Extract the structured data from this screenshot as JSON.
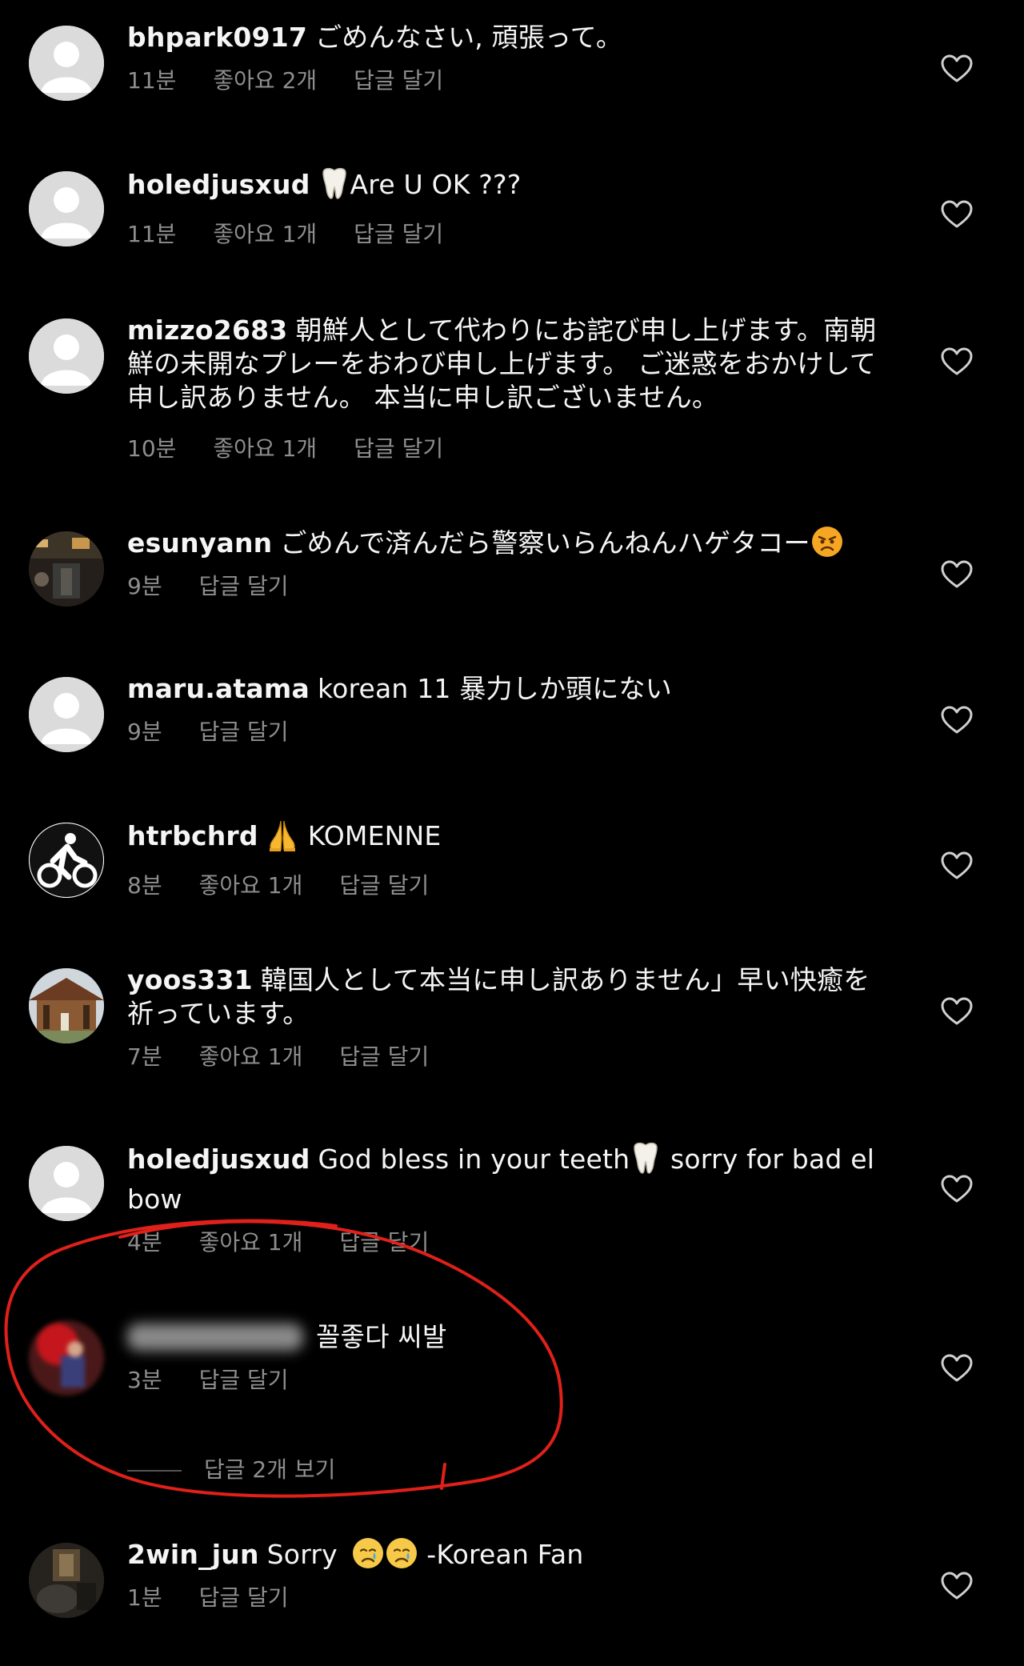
{
  "reply_label": "답글 달기",
  "comments": [
    {
      "username": "bhpark0917",
      "text": "ごめんなさい, 頑張って。",
      "time": "11분",
      "likes": "좋아요 2개"
    },
    {
      "username": "holedjusxud",
      "text": "Are U OK ???",
      "time": "11분",
      "likes": "좋아요 1개"
    },
    {
      "username": "mizzo2683",
      "text": "朝鮮人として代わりにお詫び申し上げます。南朝鮮の未開なプレーをおわび申し上げます。 ご迷惑をおかけして申し訳ありません。 本当に申し訳ございません。",
      "time": "10분",
      "likes": "좋아요 1개"
    },
    {
      "username": "esunyann",
      "text": "ごめんで済んだら警察いらんねんハゲタコー",
      "time": "9분",
      "likes": ""
    },
    {
      "username": "maru.atama",
      "text": "korean 11 暴力しか頭にない",
      "time": "9분",
      "likes": ""
    },
    {
      "username": "htrbchrd",
      "text": "KOMENNE",
      "time": "8분",
      "likes": "좋아요 1개"
    },
    {
      "username": "yoos331",
      "text": "韓国人として本当に申し訳ありません」早い快癒を祈っています。",
      "time": "7분",
      "likes": "좋아요 1개"
    },
    {
      "username": "holedjusxud",
      "text": "God bless in your teeth",
      "text_after": " sorry for bad elbow",
      "time": "4분",
      "likes": "좋아요 1개"
    },
    {
      "username": "",
      "text": "꼴좋다 씨발",
      "time": "3분",
      "likes": "",
      "view_replies": "답글 2개 보기"
    },
    {
      "username": "2win_jun",
      "text": "Sorry",
      "text_after": " -Korean Fan",
      "time": "1분",
      "likes": ""
    }
  ],
  "icons": {
    "like": "heart-outline-icon",
    "tooth": "tooth-icon",
    "pray": "folded-hands-icon",
    "angry": "angry-face-icon",
    "cry": "crying-face-icon"
  },
  "colors": {
    "background": "#000000",
    "text": "#f5f5f5",
    "meta": "#8e8e8e",
    "annotation": "#e0201a",
    "angry_emoji": "#f5a623",
    "cry_emoji": "#f7c948"
  }
}
